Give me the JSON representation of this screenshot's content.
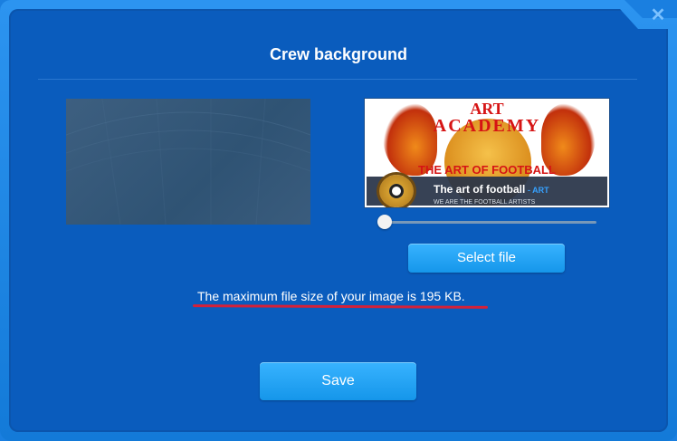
{
  "dialog": {
    "title": "Crew background",
    "close_icon": "close-icon"
  },
  "preview": {
    "art_text": "ART",
    "academy_text": "ACADEMY",
    "slogan": "THE ART OF FOOTBALL",
    "crew_name": "The art of football",
    "crew_tag": "- ART",
    "crew_motto": "WE ARE THE FOOTBALL ARTISTS"
  },
  "zoom_slider": {
    "value_fraction": 0.0
  },
  "buttons": {
    "select_file": "Select file",
    "save": "Save"
  },
  "info": {
    "max_size_text": "The maximum file size of your image is 195 KB."
  },
  "colors": {
    "panel": "#0a5cbd",
    "button": "#1596ea",
    "underline": "#d3213a"
  }
}
